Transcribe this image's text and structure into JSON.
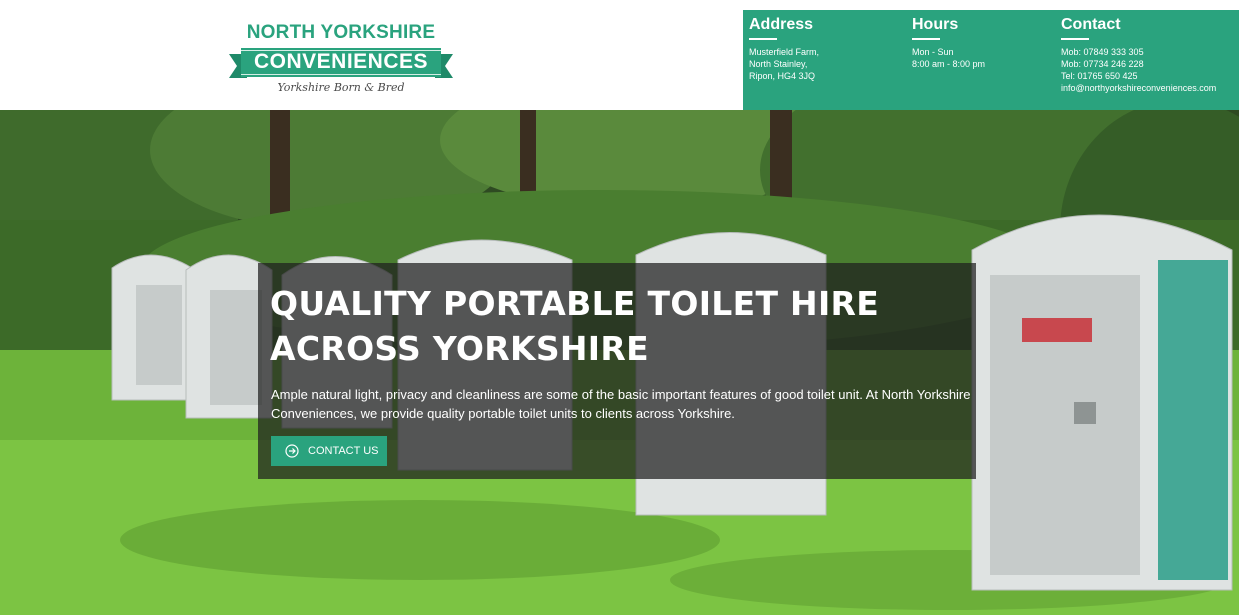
{
  "logo": {
    "line1": "NORTH YORKSHIRE",
    "line2": "CONVENIENCES",
    "tagline": "Yorkshire Born & Bred"
  },
  "info": {
    "address": {
      "heading": "Address",
      "lines": [
        "Musterfield Farm,",
        "North Stainley,",
        "Ripon, HG4 3JQ"
      ]
    },
    "hours": {
      "heading": "Hours",
      "lines": [
        "Mon - Sun",
        "8:00 am - 8:00 pm"
      ]
    },
    "contact": {
      "heading": "Contact",
      "lines": [
        "Mob: 07849 333 305",
        "Mob: 07734 246 228",
        "Tel: 01765 650 425",
        "info@northyorkshireconveniences.com"
      ]
    }
  },
  "hero": {
    "title_line1": "QUALITY PORTABLE TOILET HIRE",
    "title_line2": "ACROSS YORKSHIRE",
    "text": "Ample natural light, privacy and cleanliness are some of the basic important features of good toilet unit. At North Yorkshire Conveniences, we provide quality portable toilet units to clients across Yorkshire.",
    "cta_label": "CONTACT US",
    "cta_icon": "arrow-circle-right-icon"
  },
  "colors": {
    "brand_green": "#2aa37e",
    "white": "#ffffff",
    "overlay": "rgba(30,30,30,0.72)"
  }
}
